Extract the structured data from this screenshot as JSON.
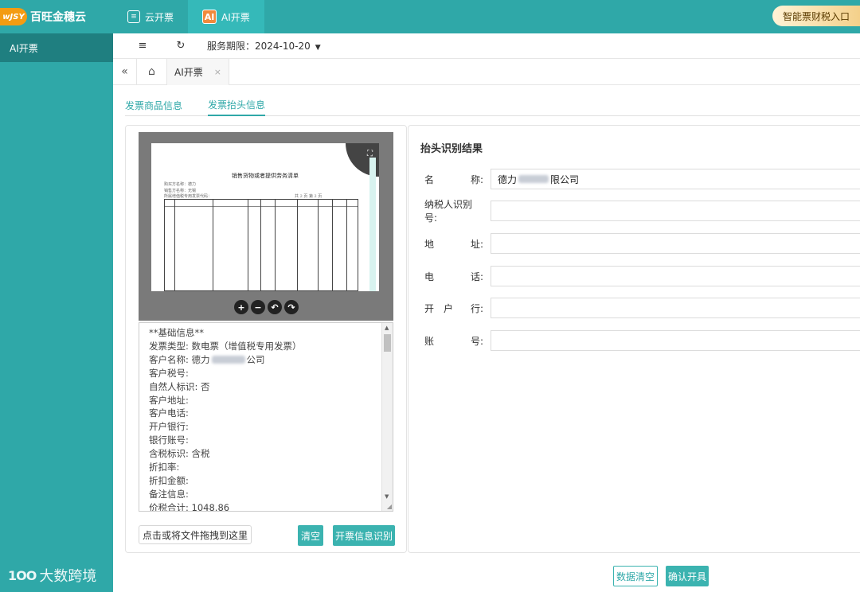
{
  "brand": {
    "logo_mark": "wJSY",
    "name": "百旺金穗云"
  },
  "top_tabs": [
    {
      "label": "云开票",
      "icon": "invoice-icon"
    },
    {
      "label": "AI开票",
      "icon": "ai-icon",
      "icon_text": "AI"
    }
  ],
  "entry_button": "智能票财税入口",
  "sidebar": {
    "items": [
      {
        "label": "AI开票"
      }
    ]
  },
  "watermark": {
    "logo": "1OO",
    "text": "大数跨境"
  },
  "toolbar": {
    "service_label": "服务期限：2024-10-20"
  },
  "page_tabs": [
    {
      "label": "AI开票",
      "close": "×"
    }
  ],
  "sub_tabs": [
    {
      "label": "发票商品信息"
    },
    {
      "label": "发票抬头信息"
    }
  ],
  "preview": {
    "doc_title": "销售货物或者提供劳务清单",
    "lines": [
      "购买方名称：德力",
      "销售方名称：无锡",
      "所属增值税专用发票代码：",
      "共 2 页 第 2 页"
    ]
  },
  "ocr_text": {
    "lines": [
      "**基础信息**",
      "发票类型: 数电票（增值税专用发票）",
      "客户名称: 德力",
      "客户税号:",
      "自然人标识: 否",
      "客户地址:",
      "客户电话:",
      "开户银行:",
      "银行账号:",
      "含税标识: 含税",
      "折扣率:",
      "折扣金额:",
      "备注信息:",
      "价税合计: 1048.86"
    ],
    "name_suffix": "公司"
  },
  "left_buttons": {
    "upload": "点击或将文件拖拽到这里",
    "clear": "清空",
    "recognize": "开票信息识别"
  },
  "result": {
    "title": "抬头识别结果",
    "fields": [
      {
        "label_a": "名",
        "label_b": "称:",
        "value": "德力",
        "value_suffix": "限公司"
      },
      {
        "label_a": "纳税人识别号:",
        "label_b": "",
        "value": ""
      },
      {
        "label_a": "地",
        "label_b": "址:",
        "value": ""
      },
      {
        "label_a": "电",
        "label_b": "话:",
        "value": ""
      },
      {
        "label_a": "开　户",
        "label_b": "行:",
        "value": ""
      },
      {
        "label_a": "账",
        "label_b": "号:",
        "value": ""
      }
    ]
  },
  "bottom_buttons": {
    "clear_data": "数据清空",
    "confirm": "确认开具"
  },
  "colors": {
    "teal": "#2fa8a8",
    "sidebar_active": "#1f7f80",
    "orange": "#f39c12"
  }
}
